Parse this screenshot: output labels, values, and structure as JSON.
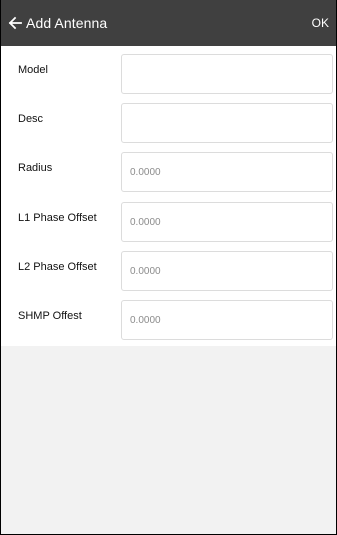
{
  "header": {
    "title": "Add Antenna",
    "ok_label": "OK",
    "bg_color": "#404040"
  },
  "form": {
    "fields": [
      {
        "label": "Model",
        "value": "",
        "placeholder": ""
      },
      {
        "label": "Desc",
        "value": "",
        "placeholder": ""
      },
      {
        "label": "Radius",
        "value": "",
        "placeholder": "0.0000"
      },
      {
        "label": "L1 Phase Offset",
        "value": "",
        "placeholder": "0.0000"
      },
      {
        "label": "L2 Phase Offset",
        "value": "",
        "placeholder": "0.0000"
      },
      {
        "label": "SHMP Offest",
        "value": "",
        "placeholder": "0.0000"
      }
    ]
  }
}
